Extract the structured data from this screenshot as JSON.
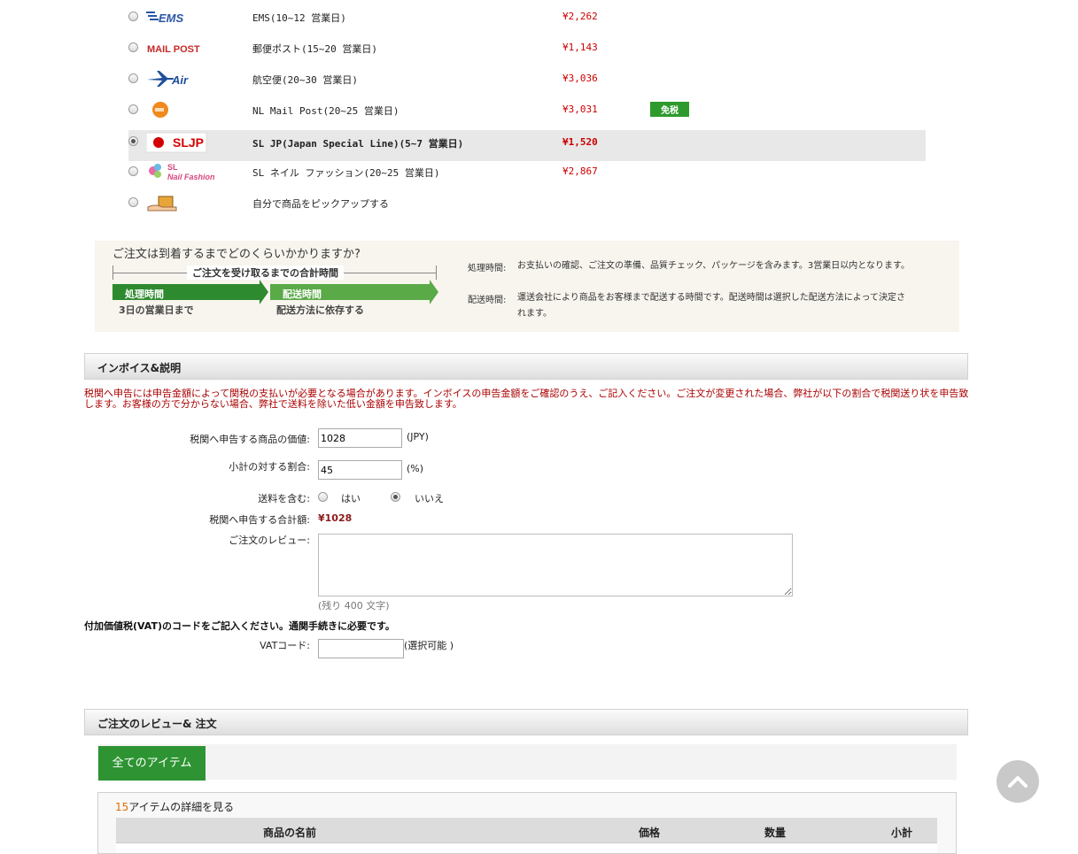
{
  "shipping": {
    "options": [
      {
        "logo": "ems-logo",
        "name": "EMS(10~12 営業日)",
        "price": "¥2,262",
        "selected": false
      },
      {
        "logo": "mail-post-logo",
        "name": "郵便ポスト(15~20 営業日)",
        "price": "¥1,143",
        "selected": false
      },
      {
        "logo": "air-logo",
        "name": "航空便(20~30 営業日)",
        "price": "¥3,036",
        "selected": false
      },
      {
        "logo": "nl-post-logo",
        "name": "NL Mail Post(20~25 営業日)",
        "price": "¥3,031",
        "selected": false,
        "badge": "免税"
      },
      {
        "logo": "sljp-logo",
        "name": "SL JP(Japan Special Line)(5~7 営業日)",
        "price": "¥1,520",
        "selected": true
      },
      {
        "logo": "sl-nail-fashion-logo",
        "name": "SL  ネイル  ファッション(20~25 営業日)",
        "price": "¥2,867",
        "selected": false
      },
      {
        "logo": "pickup-icon",
        "name": "自分で商品をピックアップする",
        "price": "",
        "selected": false
      }
    ],
    "logo_text": {
      "ems": "EMS",
      "mail": "MAIL POST",
      "air": "Air",
      "sljp": "SLJP",
      "sl": "SL",
      "nail": "Nail Fashion"
    }
  },
  "delivery_info": {
    "question": "ご注文は到着するまでどのくらいかかりますか?",
    "total_time": "ご注文を受け取るまでの合計時間",
    "processing_label": "処理時間",
    "processing_sub": "3日の営業日まで",
    "shipping_label": "配送時間",
    "shipping_sub": "配送方法に依存する",
    "processing_desc_label": "処理時間:",
    "processing_desc": "お支払いの確認、ご注文の準備、品質チェック、パッケージを含みます。3営業日以内となります。",
    "shipping_desc_label": "配送時間:",
    "shipping_desc": "運送会社により商品をお客様まで配送する時間です。配送時間は選択した配送方法によって決定されます。"
  },
  "invoice": {
    "header": "インボイス&説明",
    "notice": "税関へ申告には申告金額によって関税の支払いが必要となる場合があります。インボイスの申告金額をご確認のうえ、ご記入ください。ご注文が変更された場合、弊社が以下の割合で税関送り状を申告致します。お客様の方で分からない場合、弊社で送料を除いた低い金額を申告致します。",
    "value_label": "税関へ申告する商品の価値:",
    "value": "1028",
    "value_unit": "(JPY)",
    "ratio_label": "小計の対する割合:",
    "ratio": "45",
    "ratio_unit": "(%)",
    "include_shipping_label": "送料を含む:",
    "yes": "はい",
    "no": "いいえ",
    "include_shipping": "no",
    "total_label": "税関へ申告する合計額:",
    "total": "¥1028",
    "review_label": "ご注文のレビュー:",
    "review_value": "",
    "remaining": "(残り 400 文字)",
    "vat_notice": "付加価値税(VAT)のコードをご記入ください。通関手続きに必要です。",
    "vat_label": "VATコード:",
    "vat_value": "",
    "vat_optional": "(選択可能 )"
  },
  "review": {
    "header": "ご注文のレビュー& 注文",
    "tab_all": "全てのアイテム",
    "item_count": "15",
    "view_details": "アイテムの詳細を見る",
    "columns": [
      "商品の名前",
      "価格",
      "数量",
      "小計"
    ]
  },
  "colors": {
    "price_red": "#cc0000",
    "accent_green": "#2e9433",
    "notice_red": "#aa0000"
  }
}
